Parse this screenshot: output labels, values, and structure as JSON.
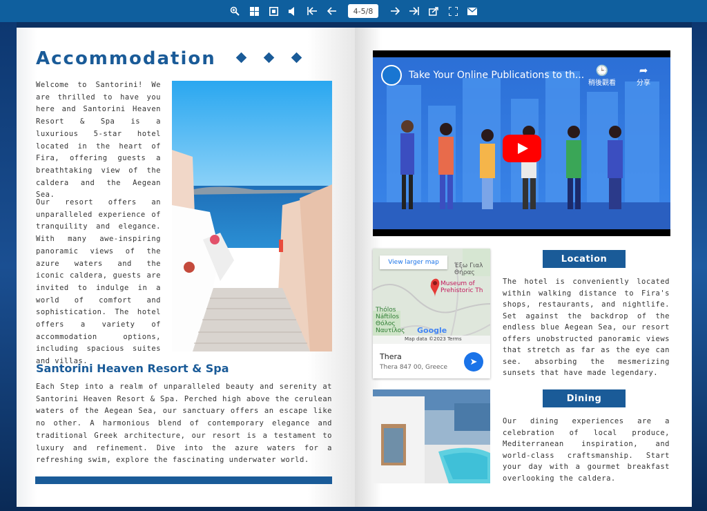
{
  "toolbar": {
    "page_indicator": "4-5/8",
    "icons": [
      "zoom-icon",
      "thumbnails-icon",
      "fit-icon",
      "sound-icon",
      "first-page-icon",
      "prev-page-icon",
      "next-page-icon",
      "last-page-icon",
      "share-icon",
      "fullscreen-icon",
      "email-icon"
    ]
  },
  "left": {
    "title": "Accommodation",
    "p1": "Welcome to Santorini! We are thrilled to have you here and Santorini Heaven Resort & Spa is a luxurious 5-star hotel located in the heart of Fira, offering guests a breathtaking view of the caldera and the Aegean Sea.",
    "p2": "Our resort offers an unparalleled experience of tranquility and elegance. With many awe-inspiring panoramic views of the azure waters and the iconic caldera, guests are invited to indulge in a world of comfort and sophistication. The hotel offers a variety of accommodation options, including spacious suites and villas.",
    "subtitle": "Santorini Heaven Resort & Spa",
    "p3": "Each Step into a realm of unparalleled beauty and serenity at Santorini Heaven Resort & Spa. Perched high above the cerulean waters of the Aegean Sea, our sanctuary offers an escape like no other. A harmonious blend of contemporary elegance and traditional Greek architecture, our resort is a testament to luxury and refinement. Dive into the azure waters for a refreshing swim, explore the fascinating underwater world."
  },
  "video": {
    "title": "Take Your Online Publications to th...",
    "watch_later": "稍後觀看",
    "share": "分享"
  },
  "map": {
    "view_larger": "View larger map",
    "label_1": "Έξω Γιαλ Θήρας",
    "label_2": "Museum of Prehistoric Th",
    "label_3": "Thólos Náftilos Θόλος Ναυτίλος",
    "google": "Google",
    "footer": "Map data ©2023   Terms",
    "place": "Thera",
    "address": "Thera 847 00, Greece"
  },
  "right": {
    "location_label": "Location",
    "location_text": "The hotel is conveniently located within walking distance to Fira's shops, restaurants, and nightlife. Set against the backdrop of the endless blue Aegean Sea, our resort offers unobstructed panoramic views that stretch as far as the eye can see. absorbing the mesmerizing sunsets that have made legendary.",
    "dining_label": "Dining",
    "dining_text": "Our dining experiences are a celebration of local produce, Mediterranean inspiration, and world-class craftsmanship. Start your day with a gourmet breakfast overlooking the caldera."
  },
  "colors": {
    "accent": "#1a5b98",
    "toolbar": "#0f5f9e"
  }
}
